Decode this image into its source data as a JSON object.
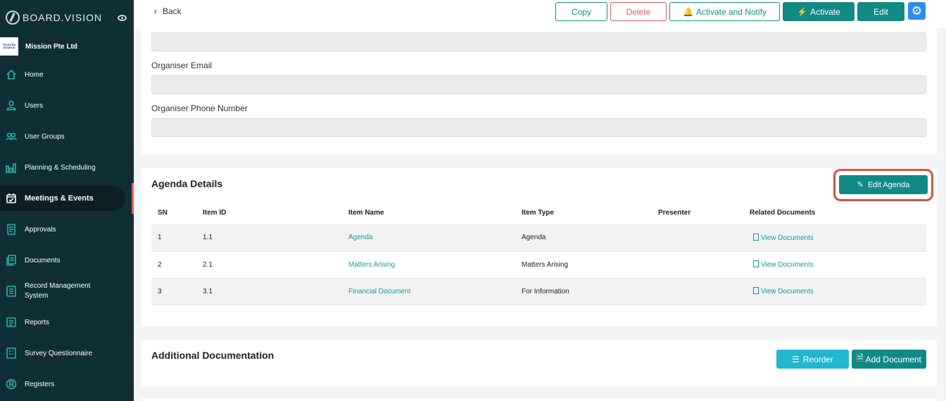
{
  "brand": {
    "name": "BOARD.VISION"
  },
  "org": {
    "logo_text": "TRUSTED SOURCE",
    "name": "Mission Pte Ltd"
  },
  "nav": [
    {
      "label": "Home",
      "icon": "home-icon"
    },
    {
      "label": "Users",
      "icon": "user-icon"
    },
    {
      "label": "User Groups",
      "icon": "users-icon"
    },
    {
      "label": "Planning & Scheduling",
      "icon": "bar-chart-icon"
    },
    {
      "label": "Meetings & Events",
      "icon": "calendar-icon",
      "active": true
    },
    {
      "label": "Approvals",
      "icon": "approval-icon"
    },
    {
      "label": "Documents",
      "icon": "documents-icon"
    },
    {
      "label": "Record Management System",
      "icon": "record-icon"
    },
    {
      "label": "Reports",
      "icon": "reports-icon"
    },
    {
      "label": "Survey Questionnaire",
      "icon": "survey-icon"
    },
    {
      "label": "Registers",
      "icon": "registers-icon"
    }
  ],
  "topbar": {
    "back": "Back",
    "copy": "Copy",
    "delete": "Delete",
    "activate_notify": "Activate and Notify",
    "activate": "Activate",
    "edit": "Edit"
  },
  "organiser": {
    "email_label": "Organiser Email",
    "email_value": "",
    "phone_label": "Organiser Phone Number",
    "phone_value": ""
  },
  "agenda": {
    "title": "Agenda Details",
    "edit_button": "Edit Agenda",
    "columns": [
      "SN",
      "Item ID",
      "Item Name",
      "Item Type",
      "Presenter",
      "Related Documents"
    ],
    "rows": [
      {
        "sn": "1",
        "item_id": "1.1",
        "item_name": "Agenda",
        "item_type": "Agenda",
        "presenter": "",
        "docs": "View Documents"
      },
      {
        "sn": "2",
        "item_id": "2.1",
        "item_name": "Matters Arising",
        "item_type": "Matters Arising",
        "presenter": "",
        "docs": "View Documents"
      },
      {
        "sn": "3",
        "item_id": "3.1",
        "item_name": "Financial Document",
        "item_type": "For Information",
        "presenter": "",
        "docs": "View Documents"
      }
    ]
  },
  "additional": {
    "title": "Additional Documentation",
    "reorder": "Reorder",
    "add_document": "Add Document"
  },
  "colors": {
    "sidebar": "#0f2e36",
    "accent": "#118a85",
    "danger": "#e05a5a",
    "highlight": "#d9523f",
    "cyan": "#22b7cf"
  }
}
